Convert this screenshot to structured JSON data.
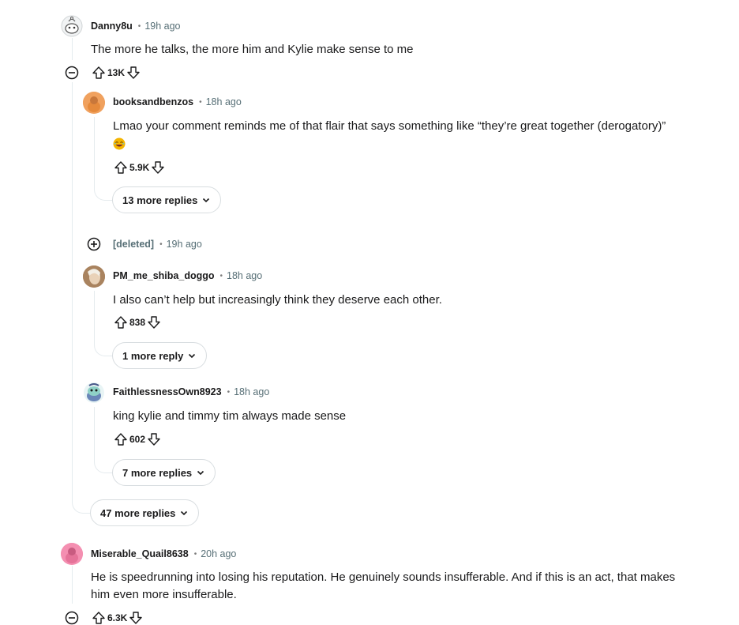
{
  "comments": [
    {
      "author": "Danny8u",
      "time": "19h ago",
      "text": "The more he talks, the more him and Kylie make sense to me",
      "votes": "13K"
    },
    {
      "author": "booksandbenzos",
      "time": "18h ago",
      "text": "Lmao your comment reminds me of that flair that says something like “they’re great together (derogatory)”",
      "votes": "5.9K",
      "more_replies": "13 more replies"
    },
    {
      "author": "[deleted]",
      "time": "19h ago"
    },
    {
      "author": "PM_me_shiba_doggo",
      "time": "18h ago",
      "text": "I also can’t help but increasingly think they deserve each other.",
      "votes": "838",
      "more_replies": "1 more reply"
    },
    {
      "author": "FaithlessnessOwn8923",
      "time": "18h ago",
      "text": "king kylie and timmy tim always made sense",
      "votes": "602",
      "more_replies": "7 more replies"
    },
    {
      "more_replies": "47 more replies"
    },
    {
      "author": "Miserable_Quail8638",
      "time": "20h ago",
      "text_line1": "He is speedrunning into losing his reputation. He genuinely sounds insufferable. And if this is an act, that makes",
      "text_line2": "him even more insufferable.",
      "votes": "6.3K"
    }
  ],
  "separator": "•",
  "colors": {
    "thread_line": "#e5ebee",
    "meta_gray": "#576f76",
    "text": "#1a1a1b",
    "button_border": "#d8dde0"
  }
}
